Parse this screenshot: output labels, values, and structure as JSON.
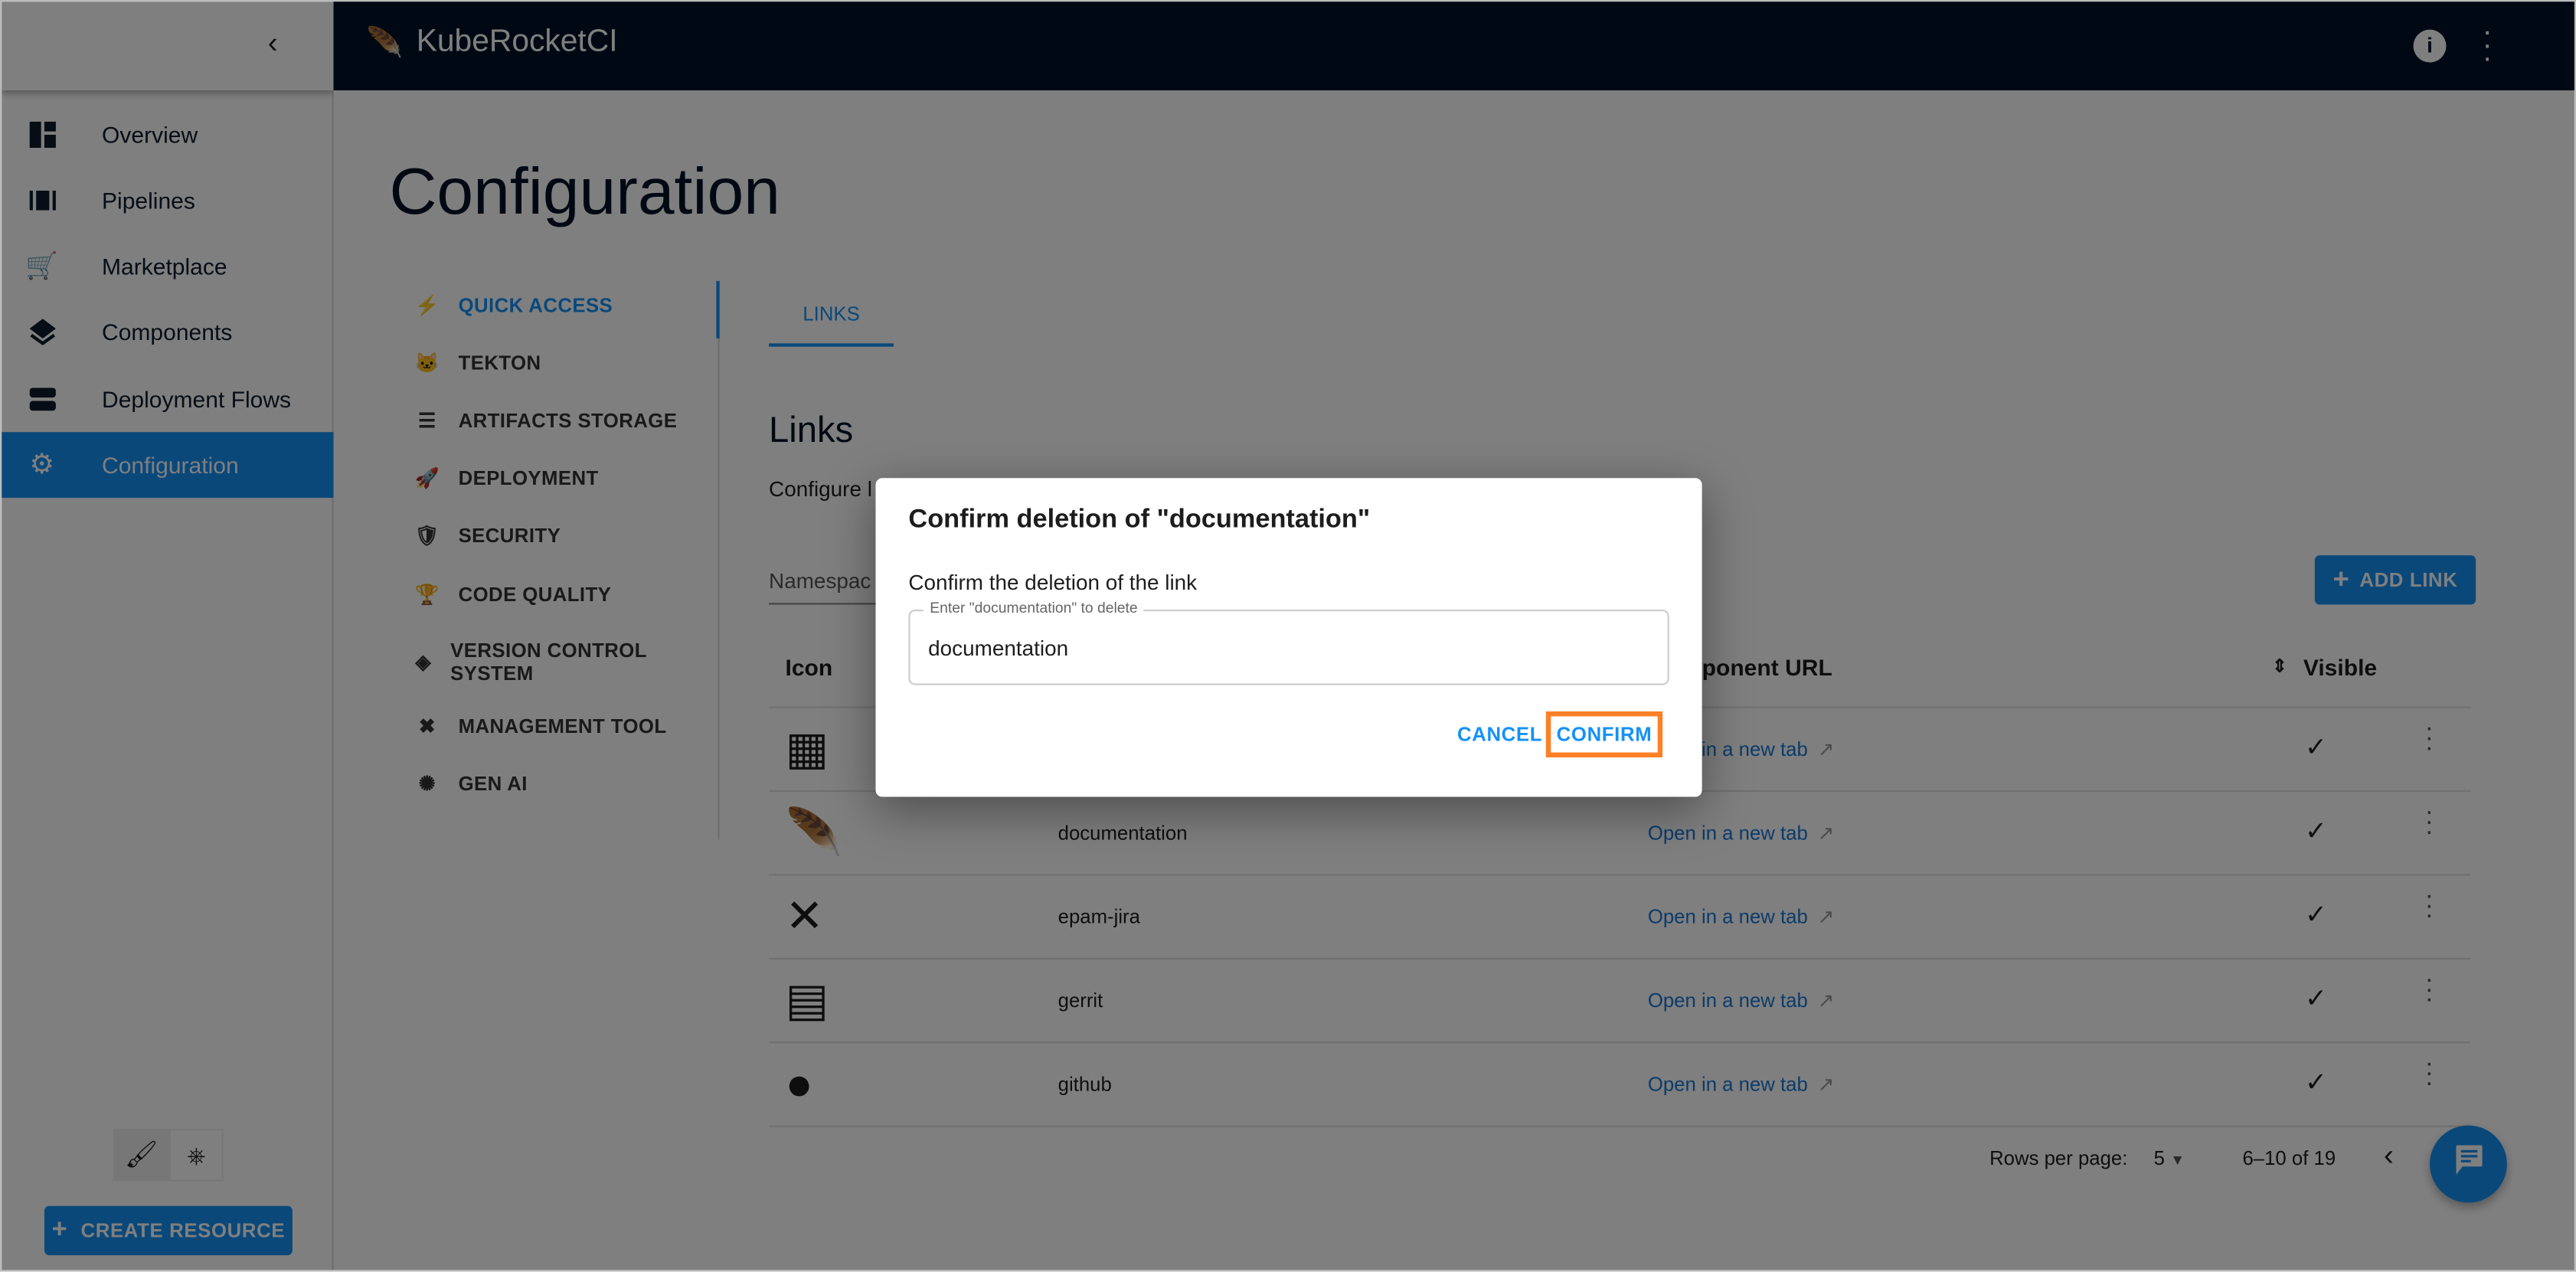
{
  "app": {
    "title": "KubeRocketCI"
  },
  "sidebar": {
    "items": [
      {
        "label": "Overview",
        "icon": "dashboard-icon"
      },
      {
        "label": "Pipelines",
        "icon": "pipelines-icon"
      },
      {
        "label": "Marketplace",
        "icon": "cart-icon"
      },
      {
        "label": "Components",
        "icon": "layers-icon"
      },
      {
        "label": "Deployment Flows",
        "icon": "flows-icon"
      },
      {
        "label": "Configuration",
        "icon": "gear-icon",
        "active": true
      }
    ],
    "create_resource": "CREATE RESOURCE"
  },
  "page": {
    "title": "Configuration"
  },
  "config_nav": [
    {
      "label": "QUICK ACCESS",
      "active": true
    },
    {
      "label": "TEKTON"
    },
    {
      "label": "ARTIFACTS STORAGE"
    },
    {
      "label": "DEPLOYMENT"
    },
    {
      "label": "SECURITY"
    },
    {
      "label": "CODE QUALITY"
    },
    {
      "label": "VERSION CONTROL SYSTEM"
    },
    {
      "label": "MANAGEMENT TOOL"
    },
    {
      "label": "GEN AI"
    }
  ],
  "tabs": [
    {
      "label": "LINKS",
      "active": true
    }
  ],
  "links": {
    "heading": "Links",
    "description": "Configure l",
    "namespace_label": "Namespac",
    "add_button": "ADD LINK",
    "columns": {
      "icon": "Icon",
      "url": "ponent URL",
      "visible": "Visible"
    },
    "rows": [
      {
        "name": "",
        "url": "Open in a new tab",
        "visible": true
      },
      {
        "name": "documentation",
        "url": "Open in a new tab",
        "visible": true
      },
      {
        "name": "epam-jira",
        "url": "Open in a new tab",
        "visible": true
      },
      {
        "name": "gerrit",
        "url": "Open in a new tab",
        "visible": true
      },
      {
        "name": "github",
        "url": "Open in a new tab",
        "visible": true
      }
    ],
    "pagination": {
      "rows_per_page_label": "Rows per page:",
      "rows_per_page": "5",
      "range": "6–10 of 19"
    }
  },
  "dialog": {
    "title": "Confirm deletion of \"documentation\"",
    "message": "Confirm the deletion of the link",
    "field_label": "Enter \"documentation\" to delete",
    "field_value": "documentation",
    "cancel": "CANCEL",
    "confirm": "CONFIRM",
    "highlight_color": "#ff7f27"
  },
  "colors": {
    "topbar": "#001327",
    "accent": "#1591f5"
  }
}
